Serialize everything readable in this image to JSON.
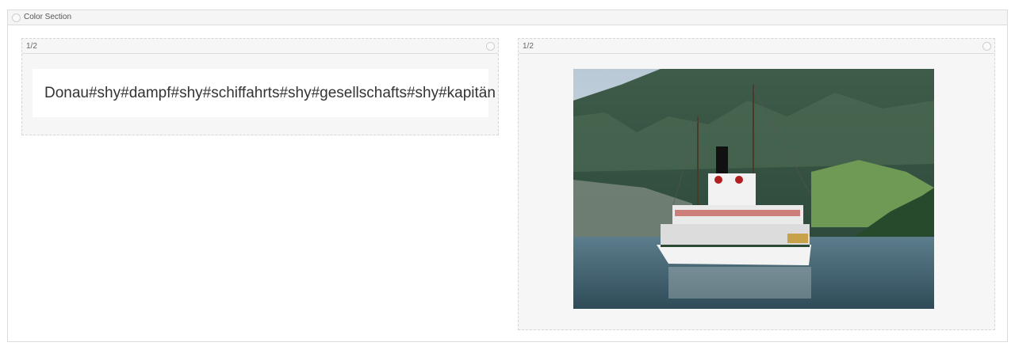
{
  "section": {
    "title": "Color Section",
    "columns": [
      {
        "label": "1/2",
        "text": "Donau#shy#dampf#shy#schiffahrts#shy#gesellschafts#shy#kapitän"
      },
      {
        "label": "1/2",
        "image": {
          "subject": "paddle steamer on mountain lake"
        }
      }
    ]
  }
}
